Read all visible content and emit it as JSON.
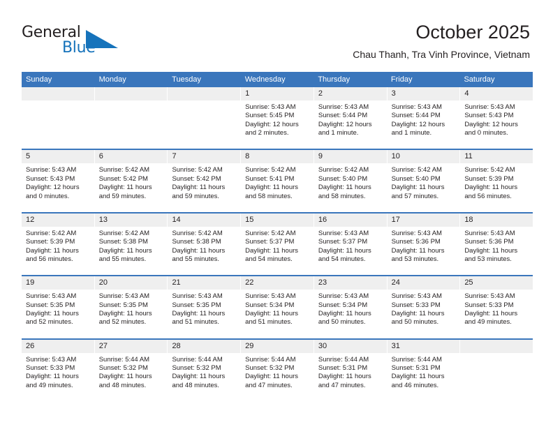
{
  "brand": {
    "name_part1": "General",
    "name_part2": "Blue",
    "triangle_icon": "triangle-icon",
    "accent_color": "#1673bb"
  },
  "header": {
    "title": "October 2025",
    "subtitle": "Chau Thanh, Tra Vinh Province, Vietnam"
  },
  "theme": {
    "header_blue": "#3a76bc",
    "daynum_gray": "#efefef",
    "text_color": "#231f20"
  },
  "calendar": {
    "weekday_headers": [
      "Sunday",
      "Monday",
      "Tuesday",
      "Wednesday",
      "Thursday",
      "Friday",
      "Saturday"
    ],
    "weeks": [
      [
        {
          "day": "",
          "sunrise": "",
          "sunset": "",
          "daylight": ""
        },
        {
          "day": "",
          "sunrise": "",
          "sunset": "",
          "daylight": ""
        },
        {
          "day": "",
          "sunrise": "",
          "sunset": "",
          "daylight": ""
        },
        {
          "day": "1",
          "sunrise": "Sunrise: 5:43 AM",
          "sunset": "Sunset: 5:45 PM",
          "daylight": "Daylight: 12 hours and 2 minutes."
        },
        {
          "day": "2",
          "sunrise": "Sunrise: 5:43 AM",
          "sunset": "Sunset: 5:44 PM",
          "daylight": "Daylight: 12 hours and 1 minute."
        },
        {
          "day": "3",
          "sunrise": "Sunrise: 5:43 AM",
          "sunset": "Sunset: 5:44 PM",
          "daylight": "Daylight: 12 hours and 1 minute."
        },
        {
          "day": "4",
          "sunrise": "Sunrise: 5:43 AM",
          "sunset": "Sunset: 5:43 PM",
          "daylight": "Daylight: 12 hours and 0 minutes."
        }
      ],
      [
        {
          "day": "5",
          "sunrise": "Sunrise: 5:43 AM",
          "sunset": "Sunset: 5:43 PM",
          "daylight": "Daylight: 12 hours and 0 minutes."
        },
        {
          "day": "6",
          "sunrise": "Sunrise: 5:42 AM",
          "sunset": "Sunset: 5:42 PM",
          "daylight": "Daylight: 11 hours and 59 minutes."
        },
        {
          "day": "7",
          "sunrise": "Sunrise: 5:42 AM",
          "sunset": "Sunset: 5:42 PM",
          "daylight": "Daylight: 11 hours and 59 minutes."
        },
        {
          "day": "8",
          "sunrise": "Sunrise: 5:42 AM",
          "sunset": "Sunset: 5:41 PM",
          "daylight": "Daylight: 11 hours and 58 minutes."
        },
        {
          "day": "9",
          "sunrise": "Sunrise: 5:42 AM",
          "sunset": "Sunset: 5:40 PM",
          "daylight": "Daylight: 11 hours and 58 minutes."
        },
        {
          "day": "10",
          "sunrise": "Sunrise: 5:42 AM",
          "sunset": "Sunset: 5:40 PM",
          "daylight": "Daylight: 11 hours and 57 minutes."
        },
        {
          "day": "11",
          "sunrise": "Sunrise: 5:42 AM",
          "sunset": "Sunset: 5:39 PM",
          "daylight": "Daylight: 11 hours and 56 minutes."
        }
      ],
      [
        {
          "day": "12",
          "sunrise": "Sunrise: 5:42 AM",
          "sunset": "Sunset: 5:39 PM",
          "daylight": "Daylight: 11 hours and 56 minutes."
        },
        {
          "day": "13",
          "sunrise": "Sunrise: 5:42 AM",
          "sunset": "Sunset: 5:38 PM",
          "daylight": "Daylight: 11 hours and 55 minutes."
        },
        {
          "day": "14",
          "sunrise": "Sunrise: 5:42 AM",
          "sunset": "Sunset: 5:38 PM",
          "daylight": "Daylight: 11 hours and 55 minutes."
        },
        {
          "day": "15",
          "sunrise": "Sunrise: 5:42 AM",
          "sunset": "Sunset: 5:37 PM",
          "daylight": "Daylight: 11 hours and 54 minutes."
        },
        {
          "day": "16",
          "sunrise": "Sunrise: 5:43 AM",
          "sunset": "Sunset: 5:37 PM",
          "daylight": "Daylight: 11 hours and 54 minutes."
        },
        {
          "day": "17",
          "sunrise": "Sunrise: 5:43 AM",
          "sunset": "Sunset: 5:36 PM",
          "daylight": "Daylight: 11 hours and 53 minutes."
        },
        {
          "day": "18",
          "sunrise": "Sunrise: 5:43 AM",
          "sunset": "Sunset: 5:36 PM",
          "daylight": "Daylight: 11 hours and 53 minutes."
        }
      ],
      [
        {
          "day": "19",
          "sunrise": "Sunrise: 5:43 AM",
          "sunset": "Sunset: 5:35 PM",
          "daylight": "Daylight: 11 hours and 52 minutes."
        },
        {
          "day": "20",
          "sunrise": "Sunrise: 5:43 AM",
          "sunset": "Sunset: 5:35 PM",
          "daylight": "Daylight: 11 hours and 52 minutes."
        },
        {
          "day": "21",
          "sunrise": "Sunrise: 5:43 AM",
          "sunset": "Sunset: 5:35 PM",
          "daylight": "Daylight: 11 hours and 51 minutes."
        },
        {
          "day": "22",
          "sunrise": "Sunrise: 5:43 AM",
          "sunset": "Sunset: 5:34 PM",
          "daylight": "Daylight: 11 hours and 51 minutes."
        },
        {
          "day": "23",
          "sunrise": "Sunrise: 5:43 AM",
          "sunset": "Sunset: 5:34 PM",
          "daylight": "Daylight: 11 hours and 50 minutes."
        },
        {
          "day": "24",
          "sunrise": "Sunrise: 5:43 AM",
          "sunset": "Sunset: 5:33 PM",
          "daylight": "Daylight: 11 hours and 50 minutes."
        },
        {
          "day": "25",
          "sunrise": "Sunrise: 5:43 AM",
          "sunset": "Sunset: 5:33 PM",
          "daylight": "Daylight: 11 hours and 49 minutes."
        }
      ],
      [
        {
          "day": "26",
          "sunrise": "Sunrise: 5:43 AM",
          "sunset": "Sunset: 5:33 PM",
          "daylight": "Daylight: 11 hours and 49 minutes."
        },
        {
          "day": "27",
          "sunrise": "Sunrise: 5:44 AM",
          "sunset": "Sunset: 5:32 PM",
          "daylight": "Daylight: 11 hours and 48 minutes."
        },
        {
          "day": "28",
          "sunrise": "Sunrise: 5:44 AM",
          "sunset": "Sunset: 5:32 PM",
          "daylight": "Daylight: 11 hours and 48 minutes."
        },
        {
          "day": "29",
          "sunrise": "Sunrise: 5:44 AM",
          "sunset": "Sunset: 5:32 PM",
          "daylight": "Daylight: 11 hours and 47 minutes."
        },
        {
          "day": "30",
          "sunrise": "Sunrise: 5:44 AM",
          "sunset": "Sunset: 5:31 PM",
          "daylight": "Daylight: 11 hours and 47 minutes."
        },
        {
          "day": "31",
          "sunrise": "Sunrise: 5:44 AM",
          "sunset": "Sunset: 5:31 PM",
          "daylight": "Daylight: 11 hours and 46 minutes."
        },
        {
          "day": "",
          "sunrise": "",
          "sunset": "",
          "daylight": ""
        }
      ]
    ]
  }
}
